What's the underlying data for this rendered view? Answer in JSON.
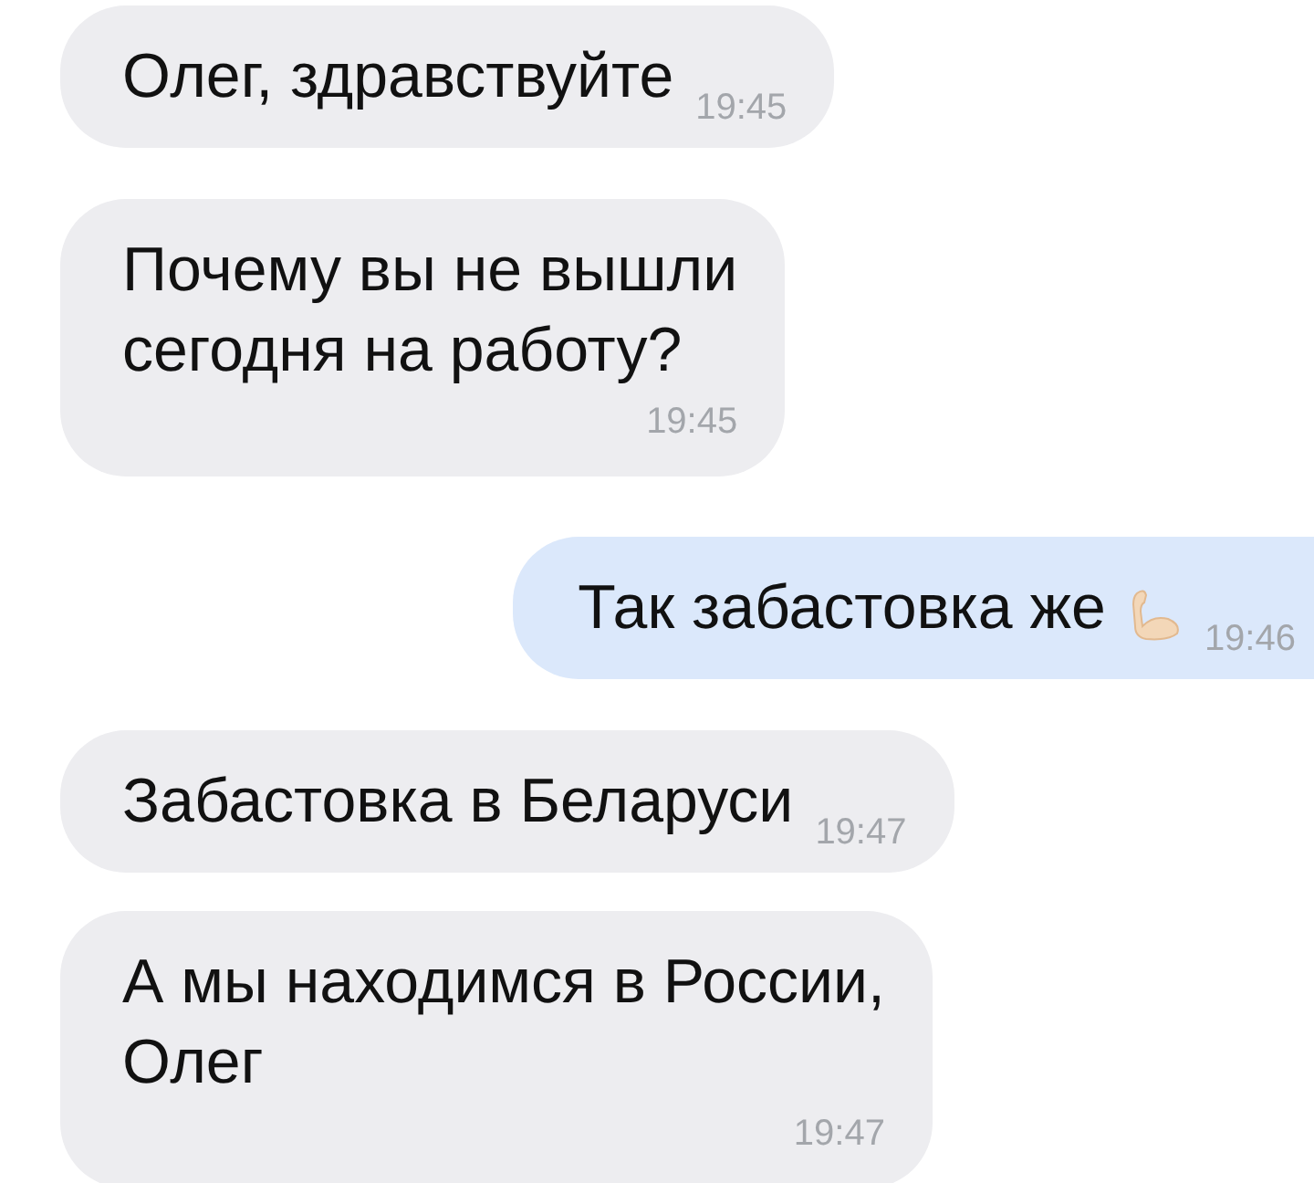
{
  "messages": [
    {
      "kind": "incoming",
      "lines": [
        "Олег, здравствуйте"
      ],
      "time": "19:45"
    },
    {
      "kind": "incoming",
      "lines": [
        "Почему вы не вышли",
        "сегодня на работу?"
      ],
      "time": "19:45"
    },
    {
      "kind": "outgoing",
      "lines": [
        "Так забастовка же"
      ],
      "icon": true,
      "time": "19:46"
    },
    {
      "kind": "incoming",
      "lines": [
        "Забастовка в Беларуси"
      ],
      "time": "19:47"
    },
    {
      "kind": "incoming",
      "lines": [
        "А мы находимся в России,",
        "Олег"
      ],
      "time": "19:47"
    }
  ]
}
